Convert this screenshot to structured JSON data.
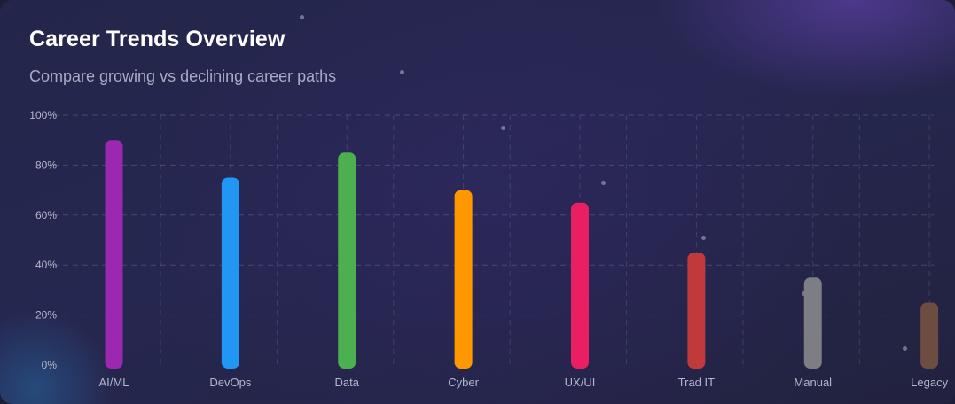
{
  "title": "Career Trends Overview",
  "subtitle": "Compare growing vs declining career paths",
  "chart_data": {
    "type": "bar",
    "title": "Career Trends Overview",
    "subtitle": "Compare growing vs declining career paths",
    "xlabel": "",
    "ylabel": "",
    "categories": [
      "AI/ML",
      "DevOps",
      "Data",
      "Cyber",
      "UX/UI",
      "Trad IT",
      "Manual",
      "Legacy"
    ],
    "values": [
      90,
      75,
      85,
      70,
      65,
      45,
      35,
      25
    ],
    "colors": [
      "#9c27b0",
      "#2196f3",
      "#4caf50",
      "#ff9800",
      "#e91e63",
      "#c0393b",
      "#7d7d84",
      "#6d4c41"
    ],
    "ylim": [
      0,
      100
    ],
    "y_ticks": [
      "0%",
      "20%",
      "40%",
      "60%",
      "80%",
      "100%"
    ],
    "grid": true,
    "legend": "none"
  }
}
